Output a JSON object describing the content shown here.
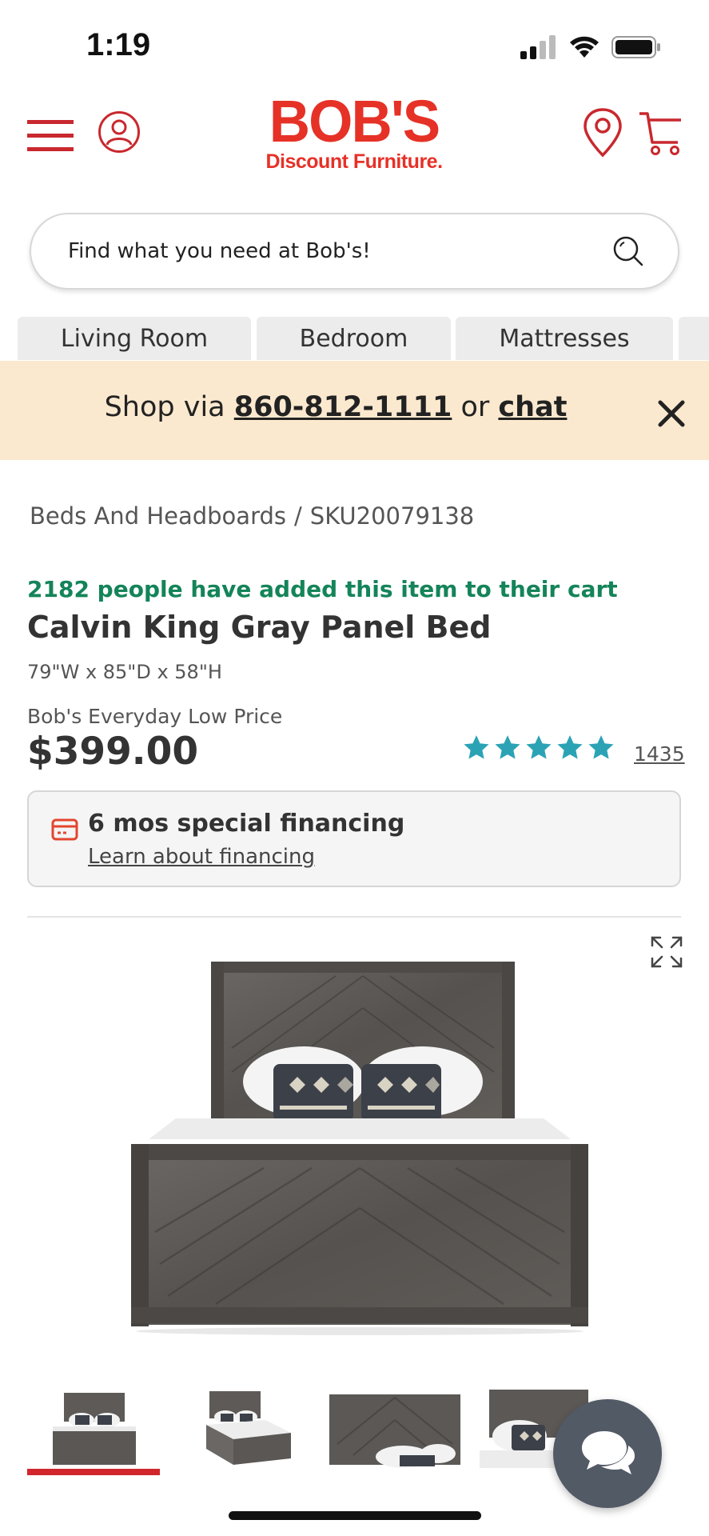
{
  "status_bar": {
    "time": "1:19"
  },
  "header": {
    "logo_main": "BOB'S",
    "logo_sub": "Discount Furniture."
  },
  "search": {
    "placeholder": "Find what you need at Bob's!"
  },
  "categories": [
    "Living Room",
    "Bedroom",
    "Mattresses"
  ],
  "promo": {
    "prefix": "Shop via ",
    "phone": "860-812-1111",
    "middle": " or ",
    "chat": "chat"
  },
  "breadcrumb": {
    "category": "Beds And Headboards",
    "separator": "/",
    "sku": "SKU20079138"
  },
  "product": {
    "cart_count_text": "2182 people have added this item to their cart",
    "title": "Calvin King Gray Panel Bed",
    "dimensions": "79\"W x 85\"D x 58\"H",
    "price_label": "Bob's Everyday Low Price",
    "price": "$399.00",
    "rating": 5,
    "rating_max": 5,
    "review_count": "1435"
  },
  "financing": {
    "title": "6 mos special financing",
    "link": "Learn about financing"
  },
  "colors": {
    "brand_red": "#e63127",
    "promo_bg": "#fbe9cf",
    "cart_green": "#148459",
    "star_teal": "#2ba3b5",
    "chat_fab": "#525a66"
  },
  "gallery": {
    "selected_index": 0,
    "thumbnail_count": 4
  }
}
